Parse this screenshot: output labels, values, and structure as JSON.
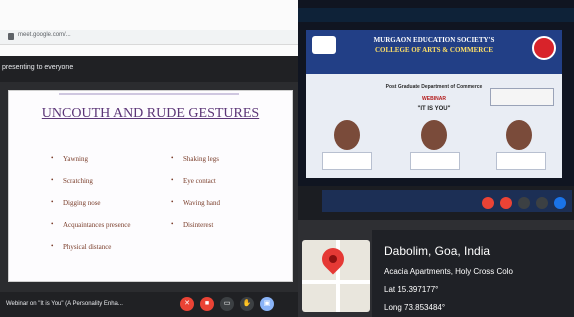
{
  "meet": {
    "url": "meet.google.com/...",
    "presenting_banner": "presenting to everyone",
    "meeting_title": "Webinar on \"It is You\" (A Personality Enha..."
  },
  "slide": {
    "title": "UNCOUTH AND RUDE GESTURES",
    "left_items": [
      "Yawning",
      "Scratching",
      "Digging nose",
      "Acquaintances presence",
      "Physical distance"
    ],
    "right_items": [
      "Shaking legs",
      "Eye contact",
      "Waving hand",
      "Disinterest"
    ]
  },
  "poster": {
    "organisation": "MURGAON EDUCATION SOCIETY'S",
    "college": "COLLEGE OF ARTS & COMMERCE",
    "department": "Post Graduate Department of Commerce",
    "mode": "WEBINAR",
    "theme": "\"IT IS YOU\""
  },
  "location": {
    "city": "Dabolim, Goa, India",
    "address": "Acacia Apartments, Holy Cross Colo",
    "latitude": "Lat 15.397177°",
    "longitude": "Long 73.853484°"
  },
  "colors": {
    "slide_title": "#5b3577",
    "slide_text": "#7a3d2a",
    "meet_bar": "#202124",
    "end_call_red": "#ea4335",
    "map_pin": "#e53935"
  }
}
